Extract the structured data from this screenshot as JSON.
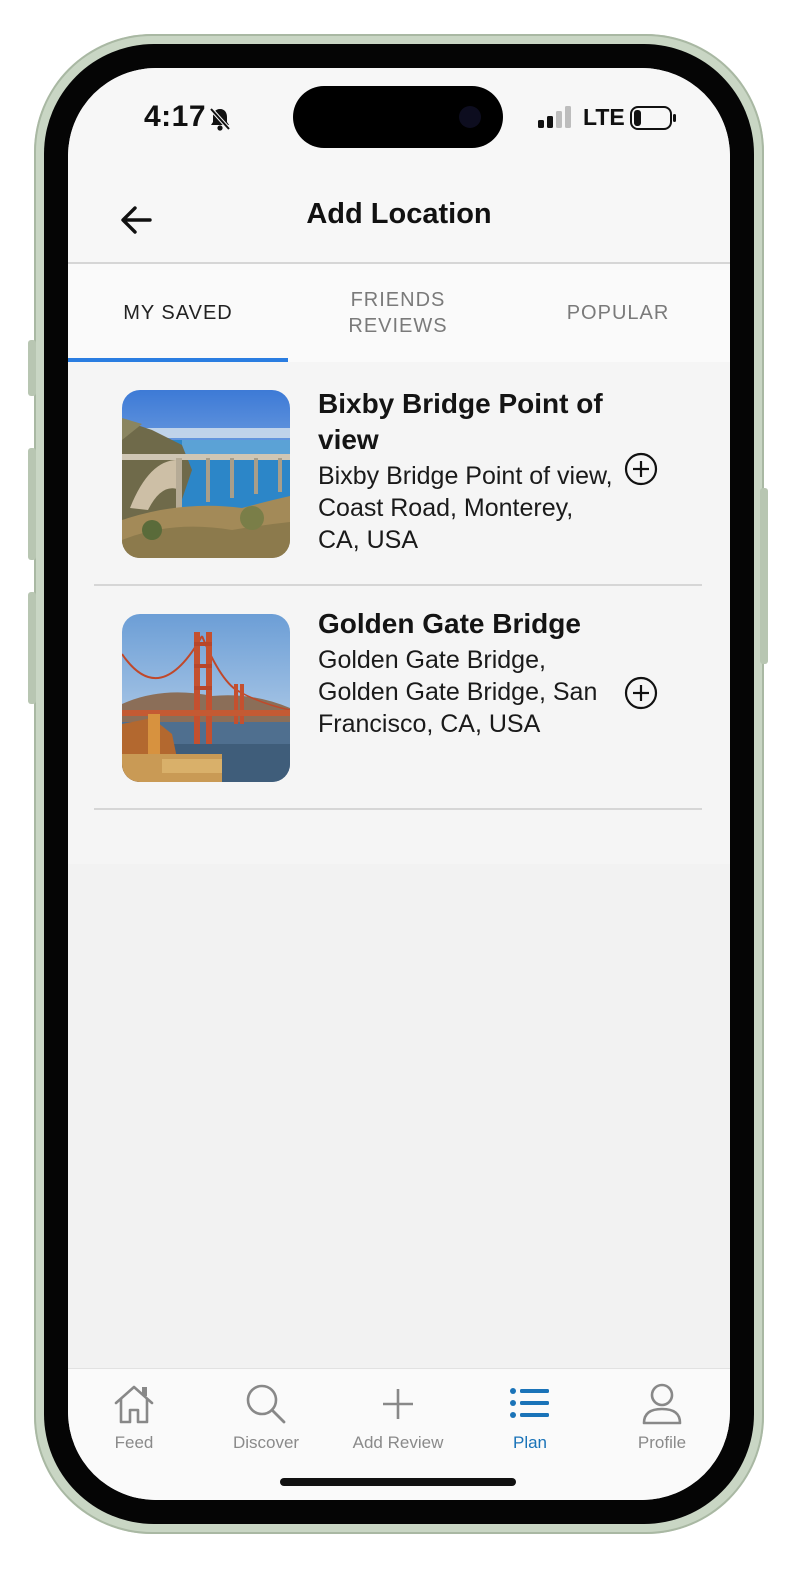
{
  "status_bar": {
    "time": "4:17",
    "network": "LTE",
    "icons": [
      "bell-slash-icon",
      "signal-icon",
      "battery-icon"
    ]
  },
  "header": {
    "title": "Add Location",
    "back_icon": "back-arrow-icon"
  },
  "tabs": [
    {
      "label": "MY SAVED",
      "active": true
    },
    {
      "label": "FRIENDS REVIEWS",
      "active": false
    },
    {
      "label": "POPULAR",
      "active": false
    }
  ],
  "locations": [
    {
      "name": "Bixby Bridge Point of view",
      "address": "Bixby Bridge Point of view, Coast Road, Monterey, CA, USA",
      "action_icon": "add-circle-icon"
    },
    {
      "name": "Golden Gate Bridge",
      "address": "Golden Gate Bridge, Golden Gate Bridge, San Francisco, CA, USA",
      "action_icon": "add-circle-icon"
    }
  ],
  "tab_bar": [
    {
      "label": "Feed",
      "icon": "home-icon",
      "active": false
    },
    {
      "label": "Discover",
      "icon": "search-icon",
      "active": false
    },
    {
      "label": "Add Review",
      "icon": "plus-icon",
      "active": false
    },
    {
      "label": "Plan",
      "icon": "list-icon",
      "active": true
    },
    {
      "label": "Profile",
      "icon": "person-icon",
      "active": false
    }
  ],
  "colors": {
    "accent": "#2a7de1",
    "active_nav": "#1a73b8",
    "inactive_text": "#8a8a8a"
  }
}
